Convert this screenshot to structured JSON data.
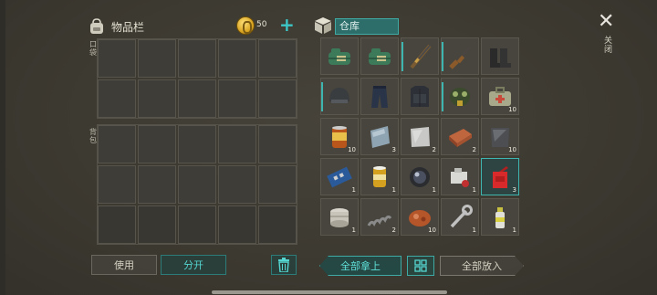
{
  "inventory": {
    "title": "物品栏",
    "coins": "50",
    "add_label": "+",
    "section_pocket": "口袋",
    "section_backpack": "背包"
  },
  "warehouse": {
    "title": "仓库",
    "items": [
      {
        "name": "duffel-bag-icon",
        "count": ""
      },
      {
        "name": "duffel-bag-icon",
        "count": ""
      },
      {
        "name": "hunting-rifle-icon",
        "count": ""
      },
      {
        "name": "assault-rifle-icon",
        "count": ""
      },
      {
        "name": "boots-icon",
        "count": ""
      },
      {
        "name": "helmet-icon",
        "count": ""
      },
      {
        "name": "tactical-pants-icon",
        "count": ""
      },
      {
        "name": "body-armor-icon",
        "count": ""
      },
      {
        "name": "gas-mask-icon",
        "count": ""
      },
      {
        "name": "medical-bag-icon",
        "count": "10"
      },
      {
        "name": "canned-food-icon",
        "count": "10"
      },
      {
        "name": "glass-sheet-icon",
        "count": "3"
      },
      {
        "name": "metal-plate-icon",
        "count": "2"
      },
      {
        "name": "brick-icon",
        "count": "2"
      },
      {
        "name": "steel-plate-icon",
        "count": "10"
      },
      {
        "name": "circuit-board-icon",
        "count": "1"
      },
      {
        "name": "oil-filter-icon",
        "count": "1"
      },
      {
        "name": "lens-icon",
        "count": "1"
      },
      {
        "name": "engine-part-icon",
        "count": "1"
      },
      {
        "name": "gas-can-icon",
        "count": "3"
      },
      {
        "name": "wire-spool-icon",
        "count": "1"
      },
      {
        "name": "spring-icon",
        "count": "2"
      },
      {
        "name": "raw-meat-icon",
        "count": "10"
      },
      {
        "name": "wrench-icon",
        "count": "1"
      },
      {
        "name": "spray-can-icon",
        "count": "1"
      }
    ]
  },
  "close_label": "关闭",
  "buttons": {
    "use": "使用",
    "split": "分开",
    "take_all": "全部拿上",
    "put_all": "全部放入"
  },
  "colors": {
    "accent_teal": "#3fb5b0",
    "background": "#3d3a32"
  }
}
